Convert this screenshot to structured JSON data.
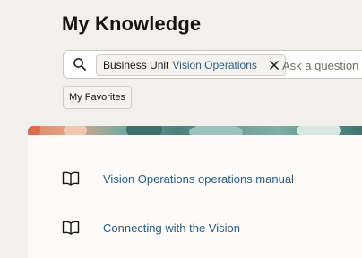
{
  "header": {
    "title": "My Knowledge"
  },
  "search": {
    "filter_chip": {
      "label": "Business Unit",
      "value": "Vision Operations"
    },
    "placeholder": "Ask a question"
  },
  "favorites_button": {
    "label": "My Favorites"
  },
  "colors": {
    "link": "#2a5b83",
    "background": "#f2f0ed",
    "panel": "#fcfbfa"
  },
  "documents": [
    {
      "icon": "book-icon",
      "title": "Vision Operations operations manual"
    },
    {
      "icon": "book-icon",
      "title": "Connecting with the Vision"
    }
  ]
}
